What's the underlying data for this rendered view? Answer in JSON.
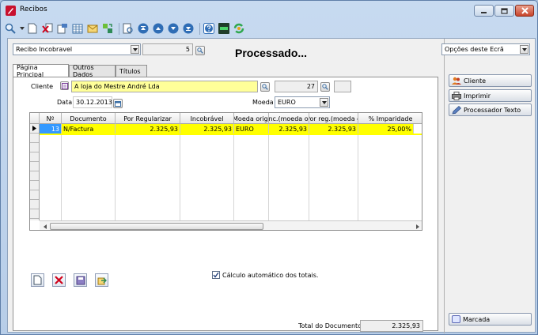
{
  "window": {
    "title": "Recibos"
  },
  "header": {
    "doc_type": "Recibo Incobravel",
    "doc_number": "5",
    "status": "Processado..."
  },
  "tabs": [
    {
      "label": "Página Principal"
    },
    {
      "label": "Outros Dados"
    },
    {
      "label": "Títulos"
    }
  ],
  "form": {
    "cliente_label": "Cliente",
    "cliente_value": "A loja do Mestre André Lda",
    "cliente_code": "27",
    "data_label": "Data",
    "data_value": "30.12.2013",
    "moeda_label": "Moeda",
    "moeda_value": "EURO"
  },
  "grid": {
    "columns": [
      "Nº",
      "Documento",
      "Por Regularizar",
      "Incobrável",
      "Moeda origi",
      "Inc.(moeda or",
      "Por reg.(moeda o",
      "% Imparidade"
    ],
    "rows": [
      {
        "num": "13",
        "documento": "N/Factura",
        "por_regularizar": "2.325,93",
        "incobravel": "2.325,93",
        "moeda": "EURO",
        "inc_moeda": "2.325,93",
        "por_reg_moeda": "2.325,93",
        "imparidade": "25,00%"
      }
    ]
  },
  "options": {
    "auto_calc_label": "Cálculo automático dos totais.",
    "auto_calc_checked": true
  },
  "totals": {
    "label": "Total do Documento",
    "value": "2.325,93"
  },
  "side": {
    "options_label": "Opções deste Ecrã",
    "buttons": [
      {
        "label": "Cliente"
      },
      {
        "label": "Imprimir"
      },
      {
        "label": "Processador Texto"
      }
    ],
    "marcada_label": "Marcada"
  },
  "colors": {
    "highlight_yellow": "#ffff00",
    "field_yellow": "#ffff99",
    "selection_blue": "#3399ff"
  }
}
